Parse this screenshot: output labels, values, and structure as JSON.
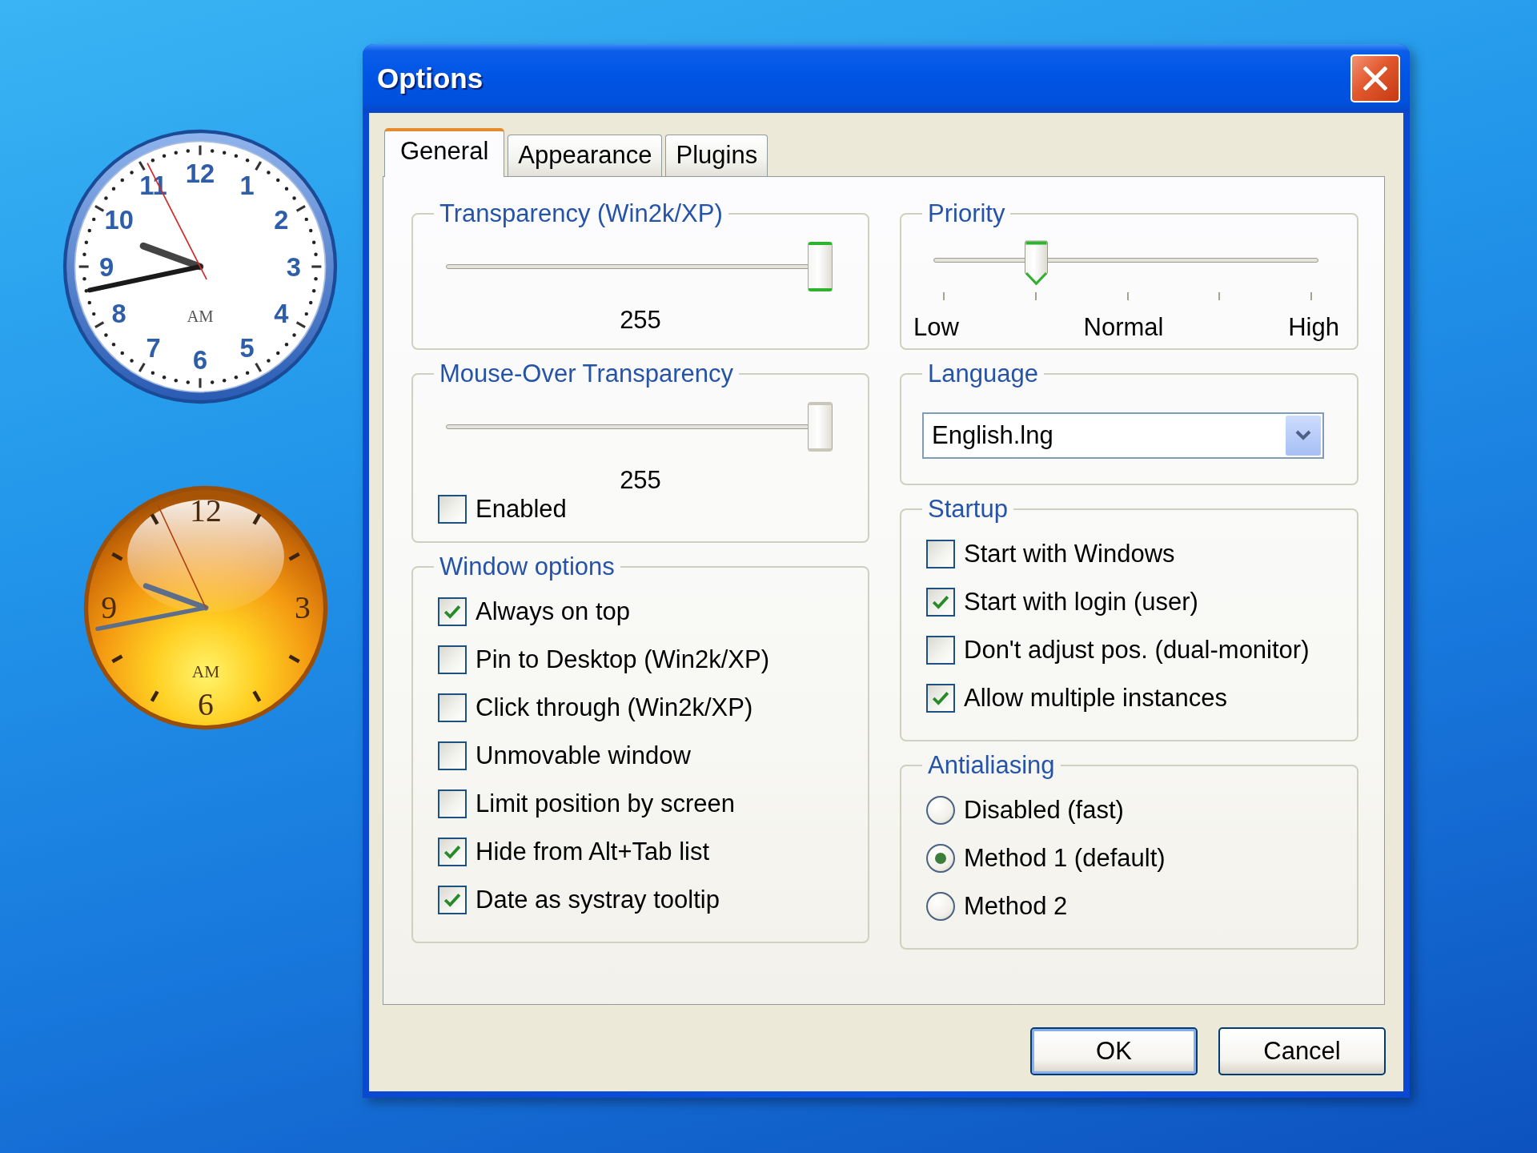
{
  "desktop": {
    "clocks": [
      {
        "kind": "classic",
        "numerals": [
          "12",
          "11",
          "1",
          "10",
          "2",
          "9",
          "3",
          "8",
          "4",
          "7",
          "5",
          "6"
        ],
        "period": "AM"
      },
      {
        "kind": "glossy",
        "numerals": [
          "12",
          "9",
          "3",
          "6"
        ],
        "period": "AM"
      }
    ]
  },
  "window": {
    "title": "Options"
  },
  "tabs": [
    {
      "label": "General",
      "selected": true
    },
    {
      "label": "Appearance",
      "selected": false
    },
    {
      "label": "Plugins",
      "selected": false
    }
  ],
  "panel": {
    "columns": [
      {
        "groups": [
          {
            "kind": "slider",
            "title": "Transparency (Win2k/XP)",
            "slider": {
              "level": 1,
              "disabled": false
            },
            "reading": "255"
          },
          {
            "kind": "slider",
            "title": "Mouse-Over Transparency",
            "slider": {
              "level": 1,
              "disabled": true
            },
            "reading": "255",
            "checkbox": {
              "label": "Enabled",
              "checked": false
            }
          },
          {
            "kind": "checkboxes",
            "title": "Window options",
            "items": [
              {
                "label": "Always on top",
                "checked": true
              },
              {
                "label": "Pin to Desktop (Win2k/XP)",
                "checked": false
              },
              {
                "label": "Click through (Win2k/XP)",
                "checked": false
              },
              {
                "label": "Unmovable window",
                "checked": false
              },
              {
                "label": "Limit position by screen",
                "checked": false
              },
              {
                "label": "Hide from Alt+Tab list",
                "checked": true
              },
              {
                "label": "Date as systray tooltip",
                "checked": true
              }
            ]
          }
        ]
      },
      {
        "groups": [
          {
            "kind": "ticked_slider",
            "title": "Priority",
            "slider": {
              "level": 0.25
            },
            "tick_labels": [
              "Low",
              "Normal",
              "High"
            ]
          },
          {
            "kind": "dropdown",
            "title": "Language",
            "value": "English.lng"
          },
          {
            "kind": "checkboxes",
            "title": "Startup",
            "items": [
              {
                "label": "Start with Windows",
                "checked": false
              },
              {
                "label": "Start with login (user)",
                "checked": true
              },
              {
                "label": "Don't adjust pos. (dual-monitor)",
                "checked": false
              },
              {
                "label": "Allow multiple instances",
                "checked": true
              }
            ]
          },
          {
            "kind": "radios",
            "title": "Antialiasing",
            "items": [
              {
                "label": "Disabled (fast)",
                "selected": false
              },
              {
                "label": "Method 1 (default)",
                "selected": true
              },
              {
                "label": "Method 2",
                "selected": false
              }
            ]
          }
        ]
      }
    ]
  },
  "buttons": [
    {
      "kind": "ok",
      "label": "OK"
    },
    {
      "kind": "cancel",
      "label": "Cancel"
    }
  ]
}
